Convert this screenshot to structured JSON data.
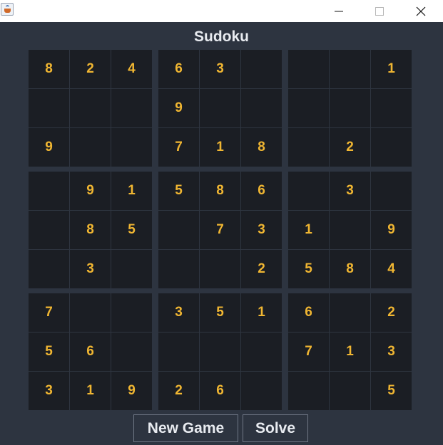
{
  "window": {
    "icon": "java-coffee-cup-icon",
    "controls": [
      "minimize-icon",
      "maximize-icon",
      "close-icon"
    ]
  },
  "game": {
    "title": "Sudoku",
    "grid": [
      [
        "8",
        "2",
        "4",
        "6",
        "3",
        "",
        "",
        "",
        "1"
      ],
      [
        "",
        "",
        "",
        "9",
        "",
        "",
        "",
        "",
        ""
      ],
      [
        "9",
        "",
        "",
        "7",
        "1",
        "8",
        "",
        "2",
        ""
      ],
      [
        "",
        "9",
        "1",
        "5",
        "8",
        "6",
        "",
        "3",
        ""
      ],
      [
        "",
        "8",
        "5",
        "",
        "7",
        "3",
        "1",
        "",
        "9"
      ],
      [
        "",
        "3",
        "",
        "",
        "",
        "2",
        "5",
        "8",
        "4"
      ],
      [
        "7",
        "",
        "",
        "3",
        "5",
        "1",
        "6",
        "",
        "2"
      ],
      [
        "5",
        "6",
        "",
        "",
        "",
        "",
        "7",
        "1",
        "3"
      ],
      [
        "3",
        "1",
        "9",
        "2",
        "6",
        "",
        "",
        "",
        "5"
      ]
    ]
  },
  "controls": {
    "new_game_label": "New Game",
    "solve_label": "Solve"
  },
  "colors": {
    "background": "#2d3440",
    "cell": "#1b1e24",
    "digit": "#f0b632",
    "text": "#e8ebf0"
  }
}
